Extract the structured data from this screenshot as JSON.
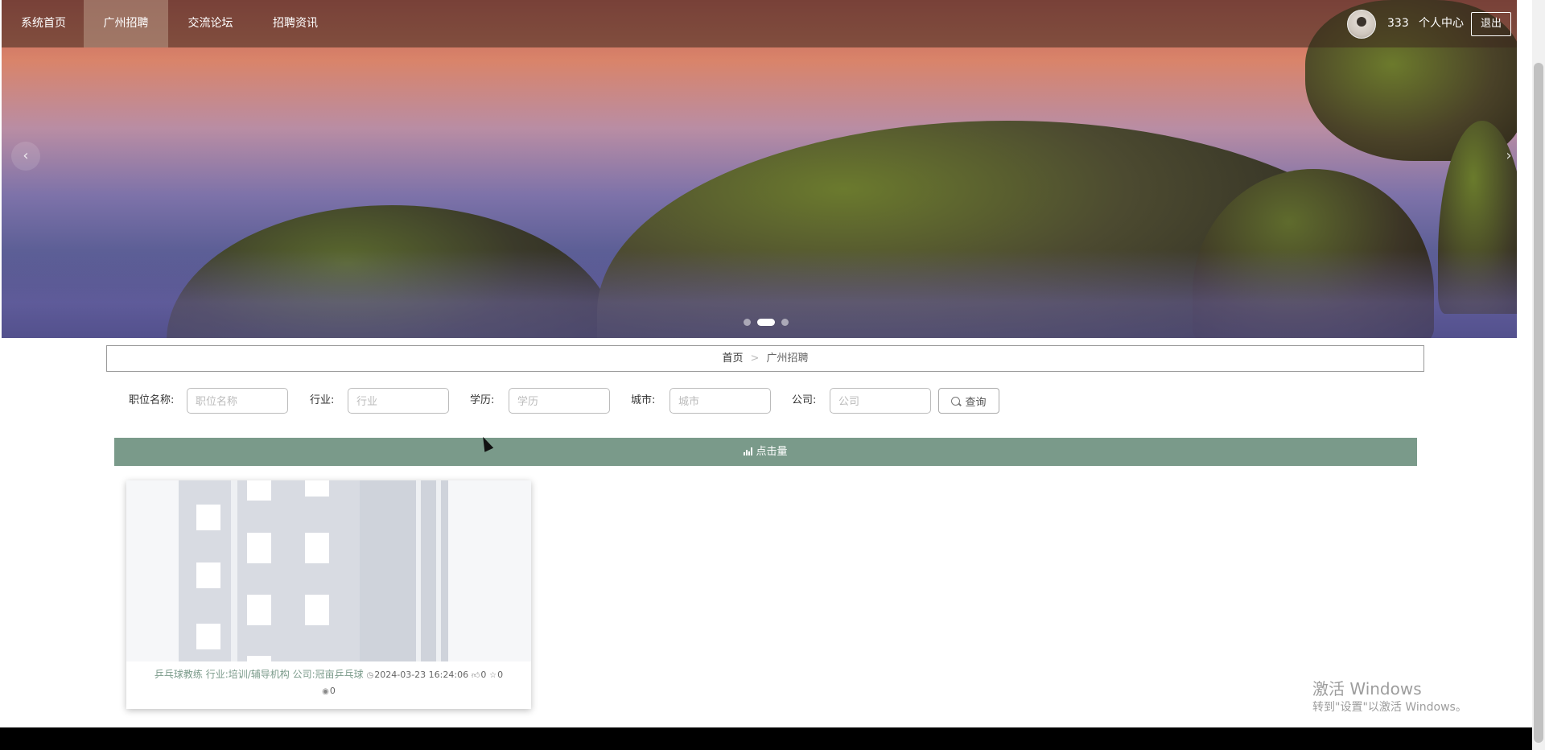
{
  "nav": {
    "items": [
      {
        "label": "系统首页",
        "active": false
      },
      {
        "label": "广州招聘",
        "active": true
      },
      {
        "label": "交流论坛",
        "active": false
      },
      {
        "label": "招聘资讯",
        "active": false
      }
    ],
    "username": "333",
    "user_center": "个人中心",
    "logout": "退出"
  },
  "carousel": {
    "prev_icon": "‹",
    "next_icon": "›",
    "slides": 3,
    "active_slide": 2
  },
  "breadcrumb": {
    "home": "首页",
    "separator": ">",
    "current": "广州招聘"
  },
  "search": {
    "fields": [
      {
        "label": "职位名称:",
        "placeholder": "职位名称"
      },
      {
        "label": "行业:",
        "placeholder": "行业"
      },
      {
        "label": "学历:",
        "placeholder": "学历"
      },
      {
        "label": "城市:",
        "placeholder": "城市"
      },
      {
        "label": "公司:",
        "placeholder": "公司"
      }
    ],
    "button": "查询"
  },
  "sortbar": {
    "label": "点击量",
    "color": "#7a9a8a"
  },
  "cards": [
    {
      "title": "乒乓球教练",
      "industry": "行业:培训/辅导机构",
      "company": "公司:冠亩乒乓球",
      "time": "2024-03-23 16:24:06",
      "likes": "0",
      "favorites": "0",
      "views": "0"
    }
  ],
  "windows_activation": {
    "line1": "激活 Windows",
    "line2": "转到\"设置\"以激活 Windows。"
  }
}
